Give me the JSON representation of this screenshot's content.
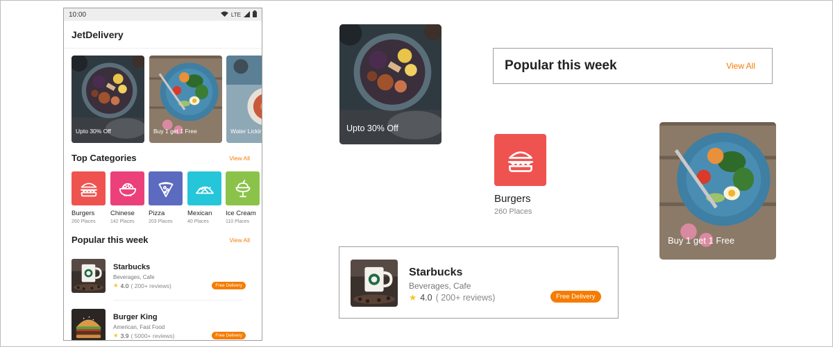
{
  "statusbar": {
    "time": "10:00",
    "network": "LTE"
  },
  "app": {
    "title": "JetDelivery"
  },
  "offers": [
    {
      "caption": "Upto 30% Off"
    },
    {
      "caption": "Buy 1 get 1 Free"
    },
    {
      "caption": "Water Licking"
    }
  ],
  "categories_section": {
    "title": "Top Categories",
    "view_all": "View All"
  },
  "categories": [
    {
      "name": "Burgers",
      "places": "260 Places",
      "color": "#ef5350",
      "icon": "burger-icon"
    },
    {
      "name": "Chinese",
      "places": "142 Places",
      "color": "#ec407a",
      "icon": "noodle-bowl-icon"
    },
    {
      "name": "Pizza",
      "places": "203 Places",
      "color": "#5c6bc0",
      "icon": "pizza-slice-icon"
    },
    {
      "name": "Mexican",
      "places": "40 Places",
      "color": "#26c6da",
      "icon": "taco-icon"
    },
    {
      "name": "Ice Cream",
      "places": "110 Places",
      "color": "#8bc34a",
      "icon": "ice-cream-icon"
    }
  ],
  "popular_section": {
    "title": "Popular this week",
    "view_all": "View All"
  },
  "restaurants": [
    {
      "name": "Starbucks",
      "type": "Beverages, Cafe",
      "rating": "4.0",
      "reviews": "( 200+ reviews)",
      "badge": "Free Delivery"
    },
    {
      "name": "Burger King",
      "type": "American, Fast Food",
      "rating": "3.9",
      "reviews": "( 5000+ reviews)",
      "badge": "Free Delivery"
    }
  ],
  "showcase": {
    "offer_card": {
      "caption": "Upto 30% Off"
    },
    "header": {
      "title": "Popular this week",
      "view_all": "View All"
    },
    "category": {
      "name": "Burgers",
      "places": "260 Places"
    },
    "offer_card_2": {
      "caption": "Buy 1 get 1 Free"
    },
    "restaurant": {
      "name": "Starbucks",
      "type": "Beverages, Cafe",
      "rating": "4.0",
      "reviews": "( 200+ reviews)",
      "badge": "Free Delivery"
    }
  },
  "colors": {
    "accent": "#f57c00",
    "star": "#fbc02d",
    "burgers_tile": "#ef5350"
  }
}
